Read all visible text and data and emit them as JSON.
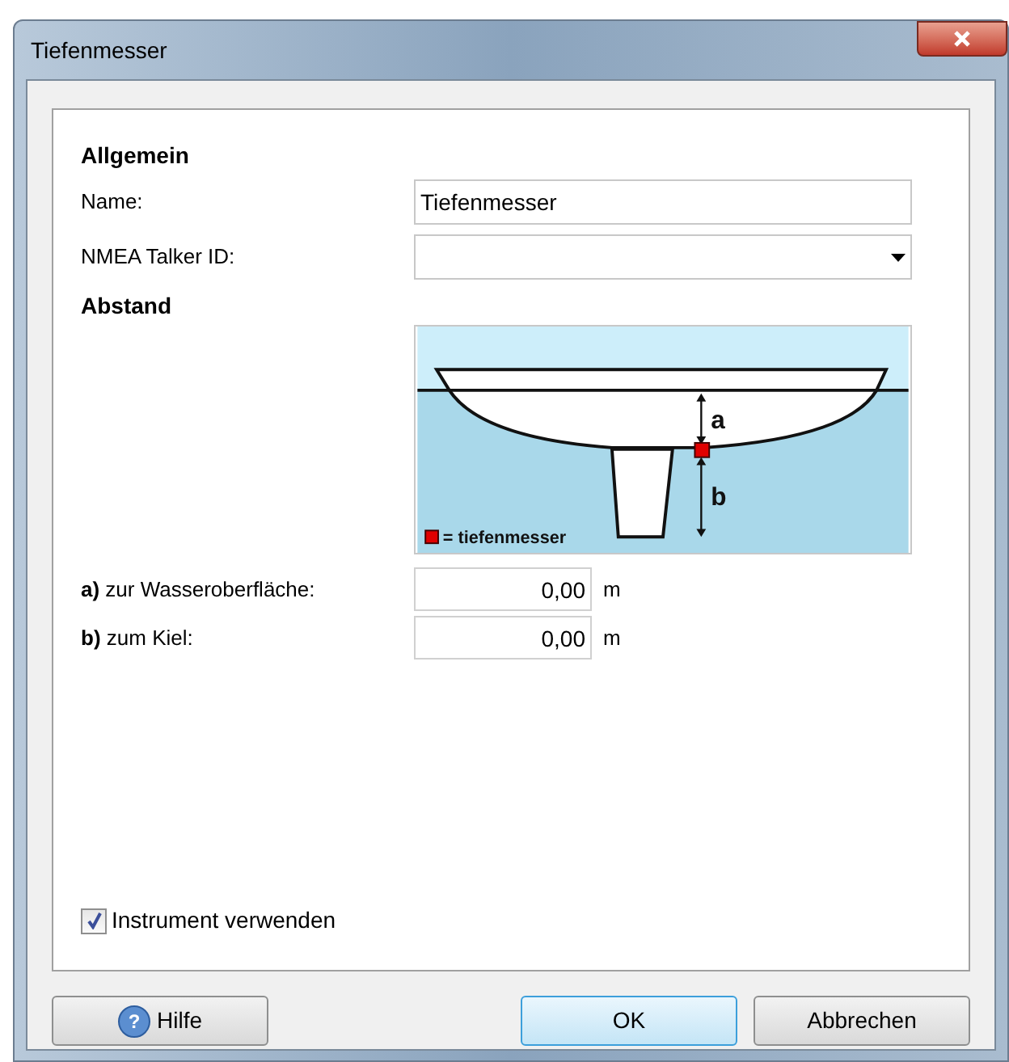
{
  "window": {
    "title": "Tiefenmesser"
  },
  "general": {
    "heading": "Allgemein",
    "name_label": "Name:",
    "name_value": "Tiefenmesser",
    "talker_label": "NMEA Talker ID:"
  },
  "distance": {
    "heading": "Abstand",
    "diagram": {
      "label_a": "a",
      "label_b": "b",
      "legend": "= tiefenmesser"
    },
    "fields": [
      {
        "label": "**a)** zur Wasseroberfläche:",
        "value": "0,00",
        "unit": "m"
      },
      {
        "label": "**b)** zum Kiel:",
        "value": "0,00",
        "unit": "m"
      }
    ]
  },
  "use_instrument": {
    "label": "Instrument verwenden",
    "checked": true
  },
  "buttons": [
    {
      "kind": "help",
      "label": "Hilfe",
      "icon": "?",
      "default": false
    },
    {
      "kind": "plain",
      "label": "OK",
      "default": true
    },
    {
      "kind": "plain",
      "label": "Abbrechen",
      "default": false
    }
  ]
}
